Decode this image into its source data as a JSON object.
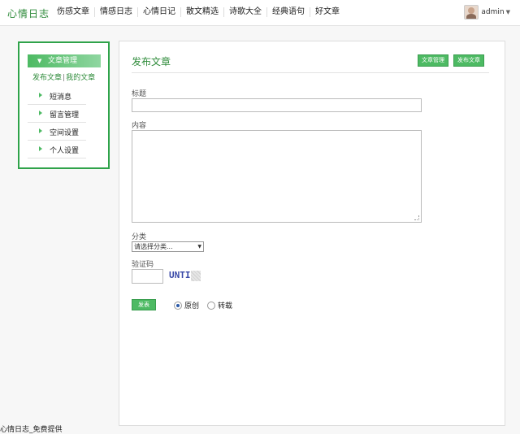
{
  "site": {
    "logo": "心情日志",
    "nav": [
      "伤感文章",
      "情感日志",
      "心情日记",
      "散文精选",
      "诗歌大全",
      "经典语句",
      "好文章"
    ],
    "user": "admin"
  },
  "sidebar": {
    "header": "文章管理",
    "sub_publish": "发布文章",
    "sub_sep": "|",
    "sub_mine": "我的文章",
    "items": [
      "短消息",
      "留言管理",
      "空间设置",
      "个人设置"
    ]
  },
  "panel": {
    "title": "发布文章",
    "btn_manage": "文章管理",
    "btn_publish": "发布文章",
    "label_title": "标题",
    "label_content": "内容",
    "label_category": "分类",
    "category_selected": "请选择分类...",
    "label_captcha": "验证码",
    "captcha_text": "UNTI",
    "submit": "发表",
    "radio_original": "原创",
    "radio_repost": "转载",
    "radio_selected": "原创"
  },
  "footer": "心情日志_免费提供",
  "colors": {
    "accent": "#2e8b3a",
    "button": "#4dba63",
    "sidebar_border": "#2fa34a"
  }
}
